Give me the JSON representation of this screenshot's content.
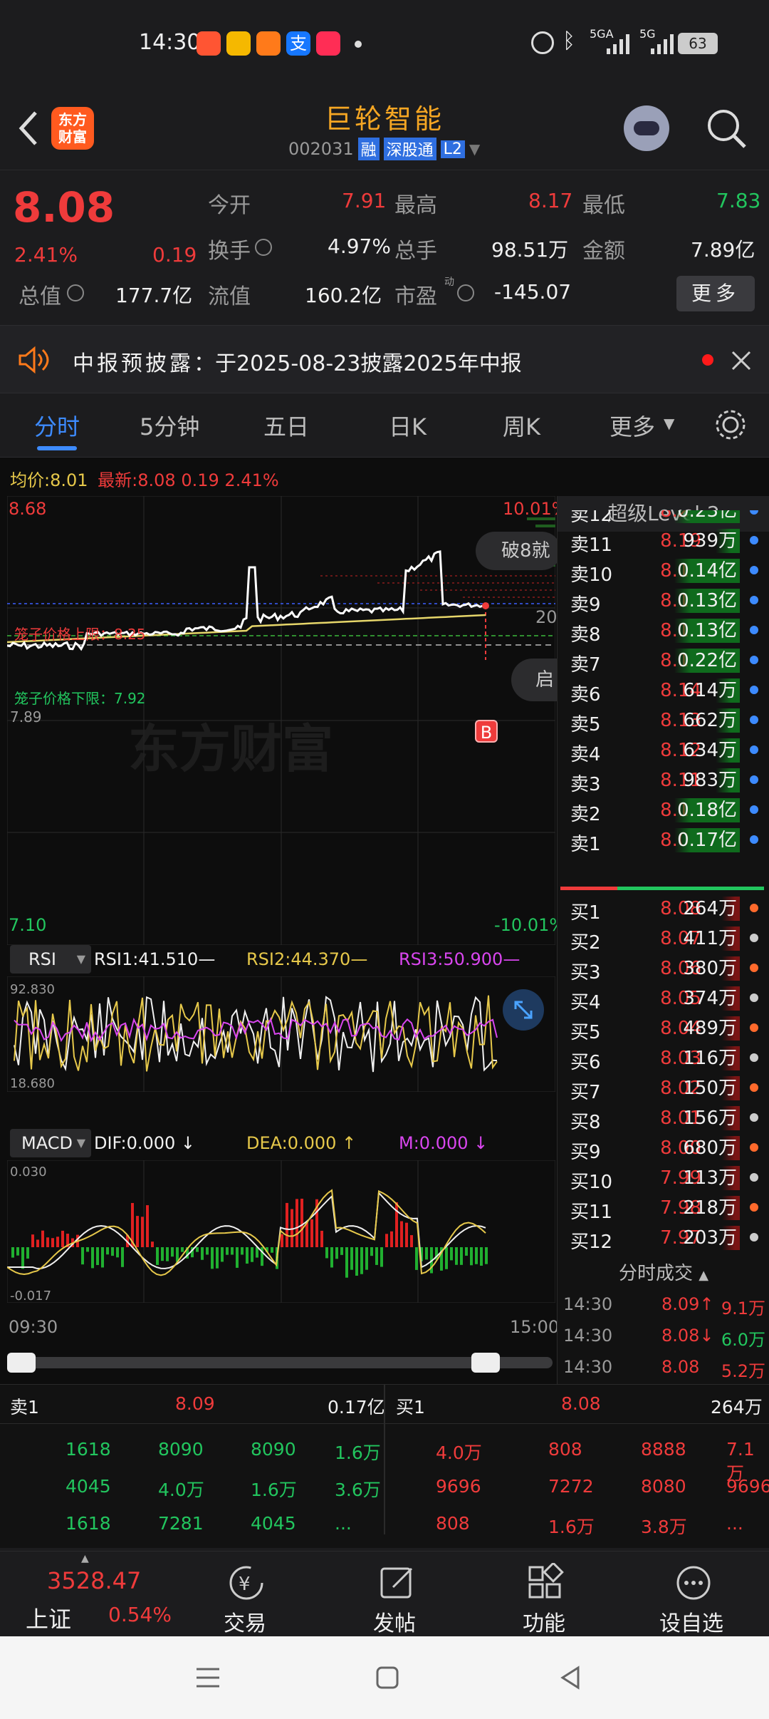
{
  "status_bar": {
    "time": "14:30",
    "network": "5GA",
    "network2": "5G",
    "battery": "63"
  },
  "header": {
    "stock_name": "巨轮智能",
    "code": "002031",
    "tags": [
      "融",
      "深股通",
      "L2"
    ],
    "app_logo": "东方\n财富",
    "app_logo_l1": "东方",
    "app_logo_l2": "财富"
  },
  "quote": {
    "price": "8.08",
    "change_pct": "2.41%",
    "change": "0.19",
    "open_label": "今开",
    "open": "7.91",
    "high_label": "最高",
    "high": "8.17",
    "low_label": "最低",
    "low": "7.83",
    "turnover_label": "换手",
    "turnover": "4.97%",
    "volume_label": "总手",
    "volume": "98.51万",
    "amount_label": "金额",
    "amount": "7.89亿",
    "mktcap_label": "总值",
    "mktcap": "177.7亿",
    "float_label": "流值",
    "float": "160.2亿",
    "pe_label": "市盈",
    "pe_sup": "动",
    "pe": "-145.07",
    "more_label": "更多"
  },
  "notice": {
    "title": "中报预披露",
    "text": "：于2025-08-23披露2025年中报"
  },
  "tabs": [
    "分时",
    "5分钟",
    "五日",
    "日K",
    "周K",
    "更多"
  ],
  "intraday": {
    "avg_label": "均价",
    "avg": "8.01",
    "last_label": "最新",
    "last": "8.08",
    "last_change": "0.19",
    "last_pct": "2.41%",
    "ymax": "8.68",
    "ymin": "7.10",
    "pct_max": "10.01%",
    "pct_min": "-10.01%",
    "upper_limit": "笼子价格上限：8.25",
    "lower_limit": "笼子价格下限：7.92",
    "low_line_label": "7.89",
    "pill_text": "破8就",
    "side_text_20": "20",
    "side_text_qi": "启",
    "watermark": "东方财富",
    "b_marker": "B",
    "time_start": "09:30",
    "time_end": "15:00"
  },
  "rsi": {
    "name": "RSI",
    "rsi1": "RSI1:41.510—",
    "rsi2": "RSI2:44.370—",
    "rsi3": "RSI3:50.900—",
    "max": "92.830",
    "min": "18.680"
  },
  "macd": {
    "name": "MACD",
    "dif": "DIF:0.000 ↓",
    "dea": "DEA:0.000 ↑",
    "m": "M:0.000 ↓",
    "max": "0.030",
    "min": "-0.017"
  },
  "orderbook": {
    "title": "超级Level-2",
    "asks": [
      {
        "label": "卖12",
        "price": "8.20",
        "vol": "0.23亿"
      },
      {
        "label": "卖11",
        "price": "8.19",
        "vol": "939万"
      },
      {
        "label": "卖10",
        "price": "8.18",
        "vol": "0.14亿"
      },
      {
        "label": "卖9",
        "price": "8.17",
        "vol": "0.13亿"
      },
      {
        "label": "卖8",
        "price": "8.16",
        "vol": "0.13亿"
      },
      {
        "label": "卖7",
        "price": "8.15",
        "vol": "0.22亿"
      },
      {
        "label": "卖6",
        "price": "8.14",
        "vol": "614万"
      },
      {
        "label": "卖5",
        "price": "8.13",
        "vol": "662万"
      },
      {
        "label": "卖4",
        "price": "8.12",
        "vol": "634万"
      },
      {
        "label": "卖3",
        "price": "8.11",
        "vol": "983万"
      },
      {
        "label": "卖2",
        "price": "8.10",
        "vol": "0.18亿"
      },
      {
        "label": "卖1",
        "price": "8.09",
        "vol": "0.17亿"
      }
    ],
    "bids": [
      {
        "label": "买1",
        "price": "8.08",
        "vol": "264万"
      },
      {
        "label": "买2",
        "price": "8.07",
        "vol": "411万"
      },
      {
        "label": "买3",
        "price": "8.06",
        "vol": "380万"
      },
      {
        "label": "买4",
        "price": "8.05",
        "vol": "374万"
      },
      {
        "label": "买5",
        "price": "8.04",
        "vol": "489万"
      },
      {
        "label": "买6",
        "price": "8.03",
        "vol": "116万"
      },
      {
        "label": "买7",
        "price": "8.02",
        "vol": "150万"
      },
      {
        "label": "买8",
        "price": "8.01",
        "vol": "156万"
      },
      {
        "label": "买9",
        "price": "8.00",
        "vol": "680万"
      },
      {
        "label": "买10",
        "price": "7.99",
        "vol": "113万"
      },
      {
        "label": "买11",
        "price": "7.98",
        "vol": "218万"
      },
      {
        "label": "买12",
        "price": "7.97",
        "vol": "203万"
      }
    ],
    "ticks_title": "分时成交",
    "ticks": [
      {
        "time": "14:30",
        "price": "8.09↑",
        "vol": "9.1万"
      },
      {
        "time": "14:30",
        "price": "8.08↓",
        "vol": "6.0万"
      },
      {
        "time": "14:30",
        "price": "8.08",
        "vol": "5.2万"
      }
    ]
  },
  "queue": {
    "sell_label": "卖1",
    "sell_price": "8.09",
    "sell_total": "0.17亿",
    "buy_label": "买1",
    "buy_price": "8.08",
    "buy_total": "264万",
    "sell_rows": [
      [
        "1618",
        "8090",
        "8090",
        "1.6万"
      ],
      [
        "4045",
        "4.0万",
        "1.6万",
        "3.6万"
      ],
      [
        "1618",
        "7281",
        "4045",
        "..."
      ]
    ],
    "buy_rows": [
      [
        "4.0万",
        "808",
        "8888",
        "7.1万"
      ],
      [
        "9696",
        "7272",
        "8080",
        "9696"
      ],
      [
        "808",
        "1.6万",
        "3.8万",
        "..."
      ]
    ]
  },
  "bottom_bar": {
    "index_value": "3528.47",
    "index_name": "上证",
    "index_pct": "0.54%",
    "items": [
      "交易",
      "发帖",
      "功能",
      "设自选"
    ]
  }
}
